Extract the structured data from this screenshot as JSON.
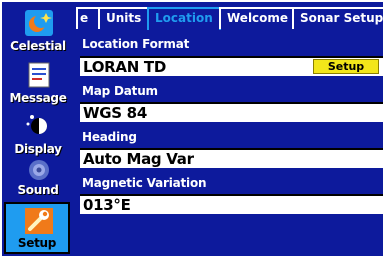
{
  "sidebar": {
    "items": [
      {
        "label": "Celestial",
        "icon": "celestial-icon"
      },
      {
        "label": "Message",
        "icon": "message-icon"
      },
      {
        "label": "Display",
        "icon": "display-icon"
      },
      {
        "label": "Sound",
        "icon": "sound-icon"
      },
      {
        "label": "Setup",
        "icon": "setup-icon",
        "selected": true
      }
    ]
  },
  "tabs": [
    {
      "label": "e"
    },
    {
      "label": "Units"
    },
    {
      "label": "Location",
      "active": true
    },
    {
      "label": "Welcome"
    },
    {
      "label": "Sonar Setup"
    }
  ],
  "location": {
    "format_label": "Location Format",
    "format_value": "LORAN TD",
    "setup_button": "Setup",
    "datum_label": "Map Datum",
    "datum_value": "WGS 84",
    "heading_label": "Heading",
    "heading_value": "Auto Mag Var",
    "magvar_label": "Magnetic Variation",
    "magvar_value": "013°E"
  },
  "colors": {
    "background": "#0d1a9c",
    "highlight": "#1f9cf0",
    "button": "#f2e61a",
    "field": "#ffffff"
  }
}
